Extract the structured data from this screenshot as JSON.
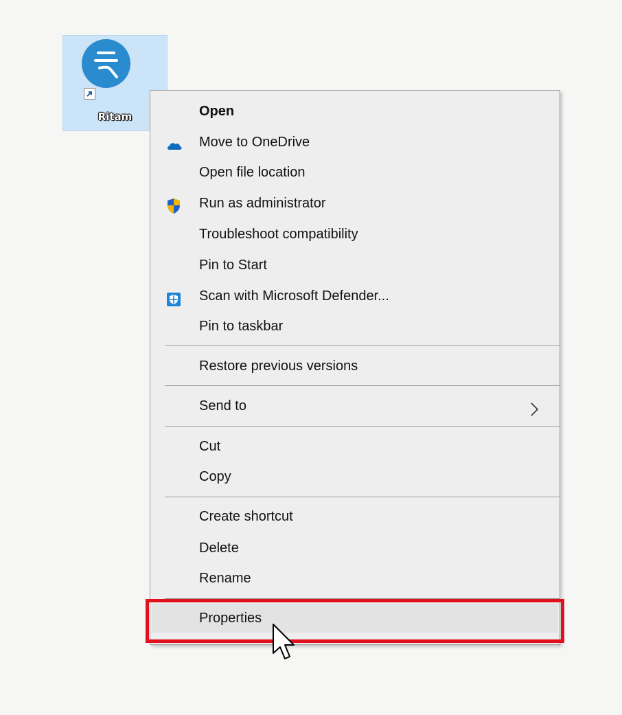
{
  "desktop": {
    "icon_label": "Ritam",
    "icon_name": "ritam-app-icon"
  },
  "context_menu": {
    "groups": [
      [
        {
          "label": "Open",
          "bold": true,
          "icon": null
        },
        {
          "label": "Move to OneDrive",
          "icon": "onedrive-cloud-icon"
        },
        {
          "label": "Open file location",
          "icon": null
        },
        {
          "label": "Run as administrator",
          "icon": "uac-shield-icon"
        },
        {
          "label": "Troubleshoot compatibility",
          "icon": null
        },
        {
          "label": "Pin to Start",
          "icon": null
        },
        {
          "label": "Scan with Microsoft Defender...",
          "icon": "defender-icon"
        },
        {
          "label": "Pin to taskbar",
          "icon": null
        }
      ],
      [
        {
          "label": "Restore previous versions",
          "icon": null
        }
      ],
      [
        {
          "label": "Send to",
          "icon": null,
          "submenu": true
        }
      ],
      [
        {
          "label": "Cut",
          "icon": null
        },
        {
          "label": "Copy",
          "icon": null
        }
      ],
      [
        {
          "label": "Create shortcut",
          "icon": null
        },
        {
          "label": "Delete",
          "icon": null
        },
        {
          "label": "Rename",
          "icon": null
        }
      ],
      [
        {
          "label": "Properties",
          "icon": null,
          "highlighted": true
        }
      ]
    ]
  },
  "colors": {
    "highlight_border": "#e2101c",
    "app_icon_bg": "#2b8bcf",
    "onedrive": "#0f6cbd",
    "defender": "#1d86d8"
  }
}
